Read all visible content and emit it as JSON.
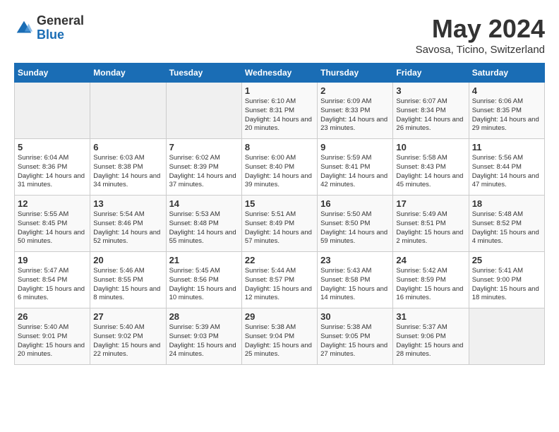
{
  "header": {
    "logo_general": "General",
    "logo_blue": "Blue",
    "month": "May 2024",
    "location": "Savosa, Ticino, Switzerland"
  },
  "days_of_week": [
    "Sunday",
    "Monday",
    "Tuesday",
    "Wednesday",
    "Thursday",
    "Friday",
    "Saturday"
  ],
  "weeks": [
    [
      {
        "day": "",
        "info": ""
      },
      {
        "day": "",
        "info": ""
      },
      {
        "day": "",
        "info": ""
      },
      {
        "day": "1",
        "info": "Sunrise: 6:10 AM\nSunset: 8:31 PM\nDaylight: 14 hours\nand 20 minutes."
      },
      {
        "day": "2",
        "info": "Sunrise: 6:09 AM\nSunset: 8:33 PM\nDaylight: 14 hours\nand 23 minutes."
      },
      {
        "day": "3",
        "info": "Sunrise: 6:07 AM\nSunset: 8:34 PM\nDaylight: 14 hours\nand 26 minutes."
      },
      {
        "day": "4",
        "info": "Sunrise: 6:06 AM\nSunset: 8:35 PM\nDaylight: 14 hours\nand 29 minutes."
      }
    ],
    [
      {
        "day": "5",
        "info": "Sunrise: 6:04 AM\nSunset: 8:36 PM\nDaylight: 14 hours\nand 31 minutes."
      },
      {
        "day": "6",
        "info": "Sunrise: 6:03 AM\nSunset: 8:38 PM\nDaylight: 14 hours\nand 34 minutes."
      },
      {
        "day": "7",
        "info": "Sunrise: 6:02 AM\nSunset: 8:39 PM\nDaylight: 14 hours\nand 37 minutes."
      },
      {
        "day": "8",
        "info": "Sunrise: 6:00 AM\nSunset: 8:40 PM\nDaylight: 14 hours\nand 39 minutes."
      },
      {
        "day": "9",
        "info": "Sunrise: 5:59 AM\nSunset: 8:41 PM\nDaylight: 14 hours\nand 42 minutes."
      },
      {
        "day": "10",
        "info": "Sunrise: 5:58 AM\nSunset: 8:43 PM\nDaylight: 14 hours\nand 45 minutes."
      },
      {
        "day": "11",
        "info": "Sunrise: 5:56 AM\nSunset: 8:44 PM\nDaylight: 14 hours\nand 47 minutes."
      }
    ],
    [
      {
        "day": "12",
        "info": "Sunrise: 5:55 AM\nSunset: 8:45 PM\nDaylight: 14 hours\nand 50 minutes."
      },
      {
        "day": "13",
        "info": "Sunrise: 5:54 AM\nSunset: 8:46 PM\nDaylight: 14 hours\nand 52 minutes."
      },
      {
        "day": "14",
        "info": "Sunrise: 5:53 AM\nSunset: 8:48 PM\nDaylight: 14 hours\nand 55 minutes."
      },
      {
        "day": "15",
        "info": "Sunrise: 5:51 AM\nSunset: 8:49 PM\nDaylight: 14 hours\nand 57 minutes."
      },
      {
        "day": "16",
        "info": "Sunrise: 5:50 AM\nSunset: 8:50 PM\nDaylight: 14 hours\nand 59 minutes."
      },
      {
        "day": "17",
        "info": "Sunrise: 5:49 AM\nSunset: 8:51 PM\nDaylight: 15 hours\nand 2 minutes."
      },
      {
        "day": "18",
        "info": "Sunrise: 5:48 AM\nSunset: 8:52 PM\nDaylight: 15 hours\nand 4 minutes."
      }
    ],
    [
      {
        "day": "19",
        "info": "Sunrise: 5:47 AM\nSunset: 8:54 PM\nDaylight: 15 hours\nand 6 minutes."
      },
      {
        "day": "20",
        "info": "Sunrise: 5:46 AM\nSunset: 8:55 PM\nDaylight: 15 hours\nand 8 minutes."
      },
      {
        "day": "21",
        "info": "Sunrise: 5:45 AM\nSunset: 8:56 PM\nDaylight: 15 hours\nand 10 minutes."
      },
      {
        "day": "22",
        "info": "Sunrise: 5:44 AM\nSunset: 8:57 PM\nDaylight: 15 hours\nand 12 minutes."
      },
      {
        "day": "23",
        "info": "Sunrise: 5:43 AM\nSunset: 8:58 PM\nDaylight: 15 hours\nand 14 minutes."
      },
      {
        "day": "24",
        "info": "Sunrise: 5:42 AM\nSunset: 8:59 PM\nDaylight: 15 hours\nand 16 minutes."
      },
      {
        "day": "25",
        "info": "Sunrise: 5:41 AM\nSunset: 9:00 PM\nDaylight: 15 hours\nand 18 minutes."
      }
    ],
    [
      {
        "day": "26",
        "info": "Sunrise: 5:40 AM\nSunset: 9:01 PM\nDaylight: 15 hours\nand 20 minutes."
      },
      {
        "day": "27",
        "info": "Sunrise: 5:40 AM\nSunset: 9:02 PM\nDaylight: 15 hours\nand 22 minutes."
      },
      {
        "day": "28",
        "info": "Sunrise: 5:39 AM\nSunset: 9:03 PM\nDaylight: 15 hours\nand 24 minutes."
      },
      {
        "day": "29",
        "info": "Sunrise: 5:38 AM\nSunset: 9:04 PM\nDaylight: 15 hours\nand 25 minutes."
      },
      {
        "day": "30",
        "info": "Sunrise: 5:38 AM\nSunset: 9:05 PM\nDaylight: 15 hours\nand 27 minutes."
      },
      {
        "day": "31",
        "info": "Sunrise: 5:37 AM\nSunset: 9:06 PM\nDaylight: 15 hours\nand 28 minutes."
      },
      {
        "day": "",
        "info": ""
      }
    ]
  ]
}
